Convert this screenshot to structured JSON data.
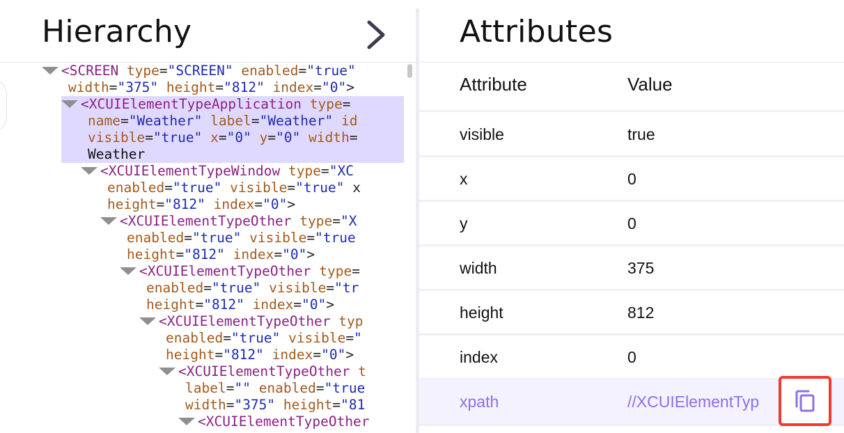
{
  "hierarchy": {
    "title": "Hierarchy",
    "tree": [
      {
        "lines": [
          [
            [
              "t",
              ""
            ],
            [
              "g",
              "<SCREEN"
            ],
            [
              "p",
              " "
            ],
            [
              "a",
              "type"
            ],
            [
              "p",
              "="
            ],
            [
              "v",
              "\"SCREEN\""
            ],
            [
              "p",
              " "
            ],
            [
              "a",
              "enabled"
            ],
            [
              "p",
              "="
            ],
            [
              "v",
              "\"true\""
            ]
          ],
          [
            [
              "a",
              "width"
            ],
            [
              "p",
              "="
            ],
            [
              "v",
              "\"375\""
            ],
            [
              "p",
              " "
            ],
            [
              "a",
              "height"
            ],
            [
              "p",
              "="
            ],
            [
              "v",
              "\"812\""
            ],
            [
              "p",
              " "
            ],
            [
              "a",
              "index"
            ],
            [
              "p",
              "="
            ],
            [
              "v",
              "\"0\""
            ],
            [
              "p",
              ">"
            ]
          ]
        ]
      },
      {
        "lines": [
          [
            [
              "t",
              ""
            ],
            [
              "g",
              "<XCUIElementTypeApplication"
            ],
            [
              "p",
              " "
            ],
            [
              "a",
              "type"
            ],
            [
              "p",
              "="
            ]
          ],
          [
            [
              "a",
              "name"
            ],
            [
              "p",
              "="
            ],
            [
              "v",
              "\"Weather\""
            ],
            [
              "p",
              " "
            ],
            [
              "a",
              "label"
            ],
            [
              "p",
              "="
            ],
            [
              "v",
              "\"Weather\""
            ],
            [
              "p",
              " "
            ],
            [
              "a",
              "id"
            ]
          ],
          [
            [
              "a",
              "visible"
            ],
            [
              "p",
              "="
            ],
            [
              "v",
              "\"true\""
            ],
            [
              "p",
              " "
            ],
            [
              "a",
              "x"
            ],
            [
              "p",
              "="
            ],
            [
              "v",
              "\"0\""
            ],
            [
              "p",
              " "
            ],
            [
              "a",
              "y"
            ],
            [
              "p",
              "="
            ],
            [
              "v",
              "\"0\""
            ],
            [
              "p",
              " "
            ],
            [
              "a",
              "width"
            ],
            [
              "p",
              "="
            ]
          ],
          [
            [
              "x",
              "Weather"
            ]
          ]
        ]
      },
      {
        "lines": [
          [
            [
              "t",
              ""
            ],
            [
              "g",
              "<XCUIElementTypeWindow"
            ],
            [
              "p",
              " "
            ],
            [
              "a",
              "type"
            ],
            [
              "p",
              "="
            ],
            [
              "v",
              "\"XC"
            ]
          ],
          [
            [
              "a",
              "enabled"
            ],
            [
              "p",
              "="
            ],
            [
              "v",
              "\"true\""
            ],
            [
              "p",
              " "
            ],
            [
              "a",
              "visible"
            ],
            [
              "p",
              "="
            ],
            [
              "v",
              "\"true\""
            ],
            [
              "p",
              " x"
            ]
          ],
          [
            [
              "a",
              "height"
            ],
            [
              "p",
              "="
            ],
            [
              "v",
              "\"812\""
            ],
            [
              "p",
              " "
            ],
            [
              "a",
              "index"
            ],
            [
              "p",
              "="
            ],
            [
              "v",
              "\"0\""
            ],
            [
              "p",
              ">"
            ]
          ]
        ]
      },
      {
        "lines": [
          [
            [
              "t",
              ""
            ],
            [
              "g",
              "<XCUIElementTypeOther"
            ],
            [
              "p",
              " "
            ],
            [
              "a",
              "type"
            ],
            [
              "p",
              "="
            ],
            [
              "v",
              "\"X"
            ]
          ],
          [
            [
              "a",
              "enabled"
            ],
            [
              "p",
              "="
            ],
            [
              "v",
              "\"true\""
            ],
            [
              "p",
              " "
            ],
            [
              "a",
              "visible"
            ],
            [
              "p",
              "="
            ],
            [
              "v",
              "\"true"
            ]
          ],
          [
            [
              "a",
              "height"
            ],
            [
              "p",
              "="
            ],
            [
              "v",
              "\"812\""
            ],
            [
              "p",
              " "
            ],
            [
              "a",
              "index"
            ],
            [
              "p",
              "="
            ],
            [
              "v",
              "\"0\""
            ],
            [
              "p",
              ">"
            ]
          ]
        ]
      },
      {
        "lines": [
          [
            [
              "t",
              ""
            ],
            [
              "g",
              "<XCUIElementTypeOther"
            ],
            [
              "p",
              " "
            ],
            [
              "a",
              "type"
            ],
            [
              "p",
              "="
            ]
          ],
          [
            [
              "a",
              "enabled"
            ],
            [
              "p",
              "="
            ],
            [
              "v",
              "\"true\""
            ],
            [
              "p",
              " "
            ],
            [
              "a",
              "visible"
            ],
            [
              "p",
              "="
            ],
            [
              "v",
              "\"tr"
            ]
          ],
          [
            [
              "a",
              "height"
            ],
            [
              "p",
              "="
            ],
            [
              "v",
              "\"812\""
            ],
            [
              "p",
              " "
            ],
            [
              "a",
              "index"
            ],
            [
              "p",
              "="
            ],
            [
              "v",
              "\"0\""
            ],
            [
              "p",
              ">"
            ]
          ]
        ]
      },
      {
        "lines": [
          [
            [
              "t",
              ""
            ],
            [
              "g",
              "<XCUIElementTypeOther"
            ],
            [
              "p",
              " "
            ],
            [
              "a",
              "typ"
            ]
          ],
          [
            [
              "a",
              "enabled"
            ],
            [
              "p",
              "="
            ],
            [
              "v",
              "\"true\""
            ],
            [
              "p",
              " "
            ],
            [
              "a",
              "visible"
            ],
            [
              "p",
              "="
            ],
            [
              "v",
              "\""
            ]
          ],
          [
            [
              "a",
              "height"
            ],
            [
              "p",
              "="
            ],
            [
              "v",
              "\"812\""
            ],
            [
              "p",
              " "
            ],
            [
              "a",
              "index"
            ],
            [
              "p",
              "="
            ],
            [
              "v",
              "\"0\""
            ],
            [
              "p",
              ">"
            ]
          ]
        ]
      },
      {
        "lines": [
          [
            [
              "t",
              ""
            ],
            [
              "g",
              "<XCUIElementTypeOther"
            ],
            [
              "p",
              " "
            ],
            [
              "a",
              "t"
            ]
          ],
          [
            [
              "a",
              "label"
            ],
            [
              "p",
              "="
            ],
            [
              "v",
              "\"\""
            ],
            [
              "p",
              " "
            ],
            [
              "a",
              "enabled"
            ],
            [
              "p",
              "="
            ],
            [
              "v",
              "\"true"
            ]
          ],
          [
            [
              "a",
              "width"
            ],
            [
              "p",
              "="
            ],
            [
              "v",
              "\"375\""
            ],
            [
              "p",
              " "
            ],
            [
              "a",
              "height"
            ],
            [
              "p",
              "="
            ],
            [
              "v",
              "\"81"
            ]
          ]
        ]
      },
      {
        "lines": [
          [
            [
              "t",
              ""
            ],
            [
              "g",
              "<XCUIElementTypeOther"
            ]
          ]
        ]
      }
    ]
  },
  "attributes": {
    "title": "Attributes",
    "header": {
      "key": "Attribute",
      "value": "Value"
    },
    "rows": [
      {
        "key": "visible",
        "value": "true"
      },
      {
        "key": "x",
        "value": "0"
      },
      {
        "key": "y",
        "value": "0"
      },
      {
        "key": "width",
        "value": "375"
      },
      {
        "key": "height",
        "value": "812"
      },
      {
        "key": "index",
        "value": "0"
      },
      {
        "key": "xpath",
        "value": "//XCUIElementTyp"
      }
    ]
  },
  "icons": {
    "expand": "chevron-right-icon",
    "copy": "copy-icon",
    "collapse": "caret-down-icon"
  },
  "colors": {
    "accent": "#8b6fea",
    "selection": "#e0d9ff",
    "copy_highlight": "#ee3b30",
    "tag": "#8a2283",
    "attr_name": "#a35a1c",
    "attr_value": "#1b2bb0"
  }
}
